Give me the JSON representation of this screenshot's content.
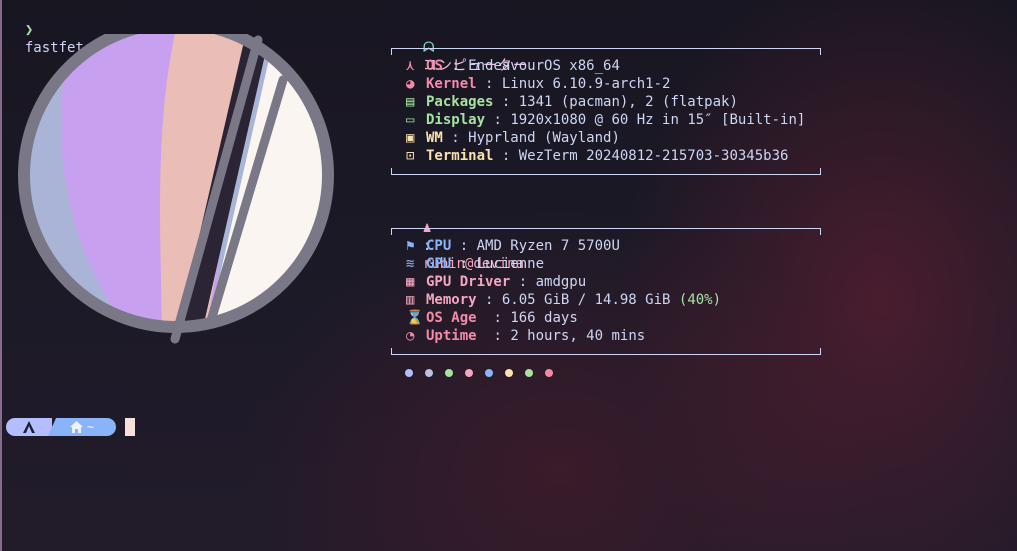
{
  "terminal": {
    "prompt_symbol": "❯",
    "command": "fastfetch"
  },
  "header": {
    "icon": "ghost-icon",
    "title": "コンピューター"
  },
  "system": [
    {
      "icon": "endeavouros-icon",
      "glyph": "⋏",
      "key": "OS",
      "value": "EndeavourOS x86_64",
      "color": "#f38ba8"
    },
    {
      "icon": "kernel-icon",
      "glyph": "◕",
      "key": "Kernel",
      "value": "Linux 6.10.9-arch1-2",
      "color": "#f38ba8"
    },
    {
      "icon": "package-icon",
      "glyph": "▤",
      "key": "Packages",
      "value": "1341 (pacman), 2 (flatpak)",
      "color": "#a6e3a1"
    },
    {
      "icon": "monitor-icon",
      "glyph": "▭",
      "key": "Display",
      "value": "1920x1080 @ 60 Hz in 15″ [Built-in]",
      "color": "#a6e3a1"
    },
    {
      "icon": "window-icon",
      "glyph": "▣",
      "key": "WM",
      "value": "Hyprland (Wayland)",
      "color": "#f9e2af"
    },
    {
      "icon": "terminal-icon",
      "glyph": "⊡",
      "key": "Terminal",
      "value": "WezTerm 20240812-215703-30345b36",
      "color": "#f9e2af"
    }
  ],
  "user": {
    "icon": "user-icon",
    "glyph": "♟",
    "value": "rubin@devina"
  },
  "hardware": [
    {
      "icon": "cpu-icon",
      "glyph": "⚑",
      "key": "CPU",
      "value": "AMD Ryzen 7 5700U",
      "color": "#89b4fa"
    },
    {
      "icon": "gpu-icon",
      "glyph": "≋",
      "key": "GPU",
      "value": "Lucienne",
      "color": "#89b4fa"
    },
    {
      "icon": "gpu-driver-icon",
      "glyph": "▦",
      "key": "GPU Driver",
      "value": "amdgpu",
      "color": "#f5a6c0"
    },
    {
      "icon": "memory-icon",
      "glyph": "▥",
      "key": "Memory",
      "value": "6.05 GiB / 14.98 GiB",
      "extra": "(40%)",
      "color": "#f5a6c0"
    },
    {
      "icon": "hourglass-icon",
      "glyph": "⌛",
      "key": "OS Age ",
      "value": "166 days",
      "color": "#f38ba8"
    },
    {
      "icon": "uptime-icon",
      "glyph": "◔",
      "key": "Uptime ",
      "value": "2 hours, 40 mins",
      "color": "#f38ba8"
    }
  ],
  "palette": [
    "#b4befe",
    "#bac2de",
    "#a6e3a1",
    "#f5a6c0",
    "#89b4fa",
    "#f9e2af",
    "#a6e3a1",
    "#f38ba8"
  ],
  "shell_prompt": {
    "arch_icon": "arch-icon",
    "home_icon": "home-icon",
    "dir": "~"
  }
}
